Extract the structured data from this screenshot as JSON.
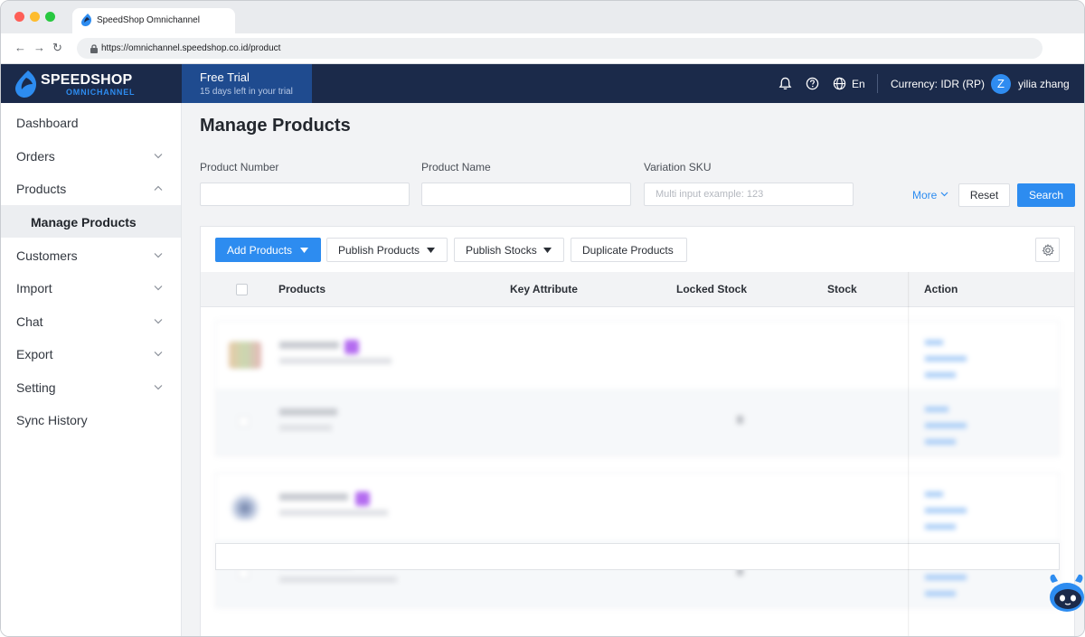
{
  "browser": {
    "tab_title": "SpeedShop Omnichannel",
    "url": "https://omnichannel.speedshop.co.id/product",
    "nav": {
      "back": "←",
      "forward": "→",
      "reload": "↻"
    }
  },
  "header": {
    "brand_name": "SPEEDSHOP",
    "brand_sub": "OMNICHANNEL",
    "trial_title": "Free Trial",
    "trial_sub": "15 days left in your trial",
    "language": "En",
    "currency": "Currency: IDR (RP)",
    "avatar_initial": "Z",
    "username": "yilia zhang",
    "icons": [
      "bell-icon",
      "help-icon",
      "globe-icon"
    ]
  },
  "sidebar": {
    "items": [
      {
        "label": "Dashboard",
        "expandable": false
      },
      {
        "label": "Orders",
        "expandable": true,
        "expanded": false
      },
      {
        "label": "Products",
        "expandable": true,
        "expanded": true
      },
      {
        "label": "Manage Products",
        "active": true
      },
      {
        "label": "Customers",
        "expandable": true,
        "expanded": false
      },
      {
        "label": "Import",
        "expandable": true,
        "expanded": false
      },
      {
        "label": "Chat",
        "expandable": true,
        "expanded": false
      },
      {
        "label": "Export",
        "expandable": true,
        "expanded": false
      },
      {
        "label": "Setting",
        "expandable": true,
        "expanded": false
      },
      {
        "label": "Sync History",
        "expandable": false
      }
    ]
  },
  "main": {
    "title": "Manage Products",
    "filters": {
      "product_number": {
        "label": "Product Number",
        "value": "",
        "placeholder": ""
      },
      "product_name": {
        "label": "Product Name",
        "value": "",
        "placeholder": ""
      },
      "variation_sku": {
        "label": "Variation SKU",
        "value": "",
        "placeholder": "Multi input example: 123"
      },
      "more_label": "More",
      "reset_label": "Reset",
      "search_label": "Search"
    },
    "toolbar": {
      "add_products": "Add Products",
      "publish_products": "Publish Products",
      "publish_stocks": "Publish Stocks",
      "duplicate_products": "Duplicate Products"
    },
    "table": {
      "columns": [
        "Products",
        "Key Attribute",
        "Locked Stock",
        "Stock",
        "Action"
      ],
      "rows_blurred": true
    }
  },
  "colors": {
    "header_bg": "#1b2a4a",
    "trial_bg": "#1f4b8f",
    "primary": "#2d8cf0",
    "sidebar_active_bg": "#eceef1",
    "content_bg": "#f2f3f5"
  }
}
